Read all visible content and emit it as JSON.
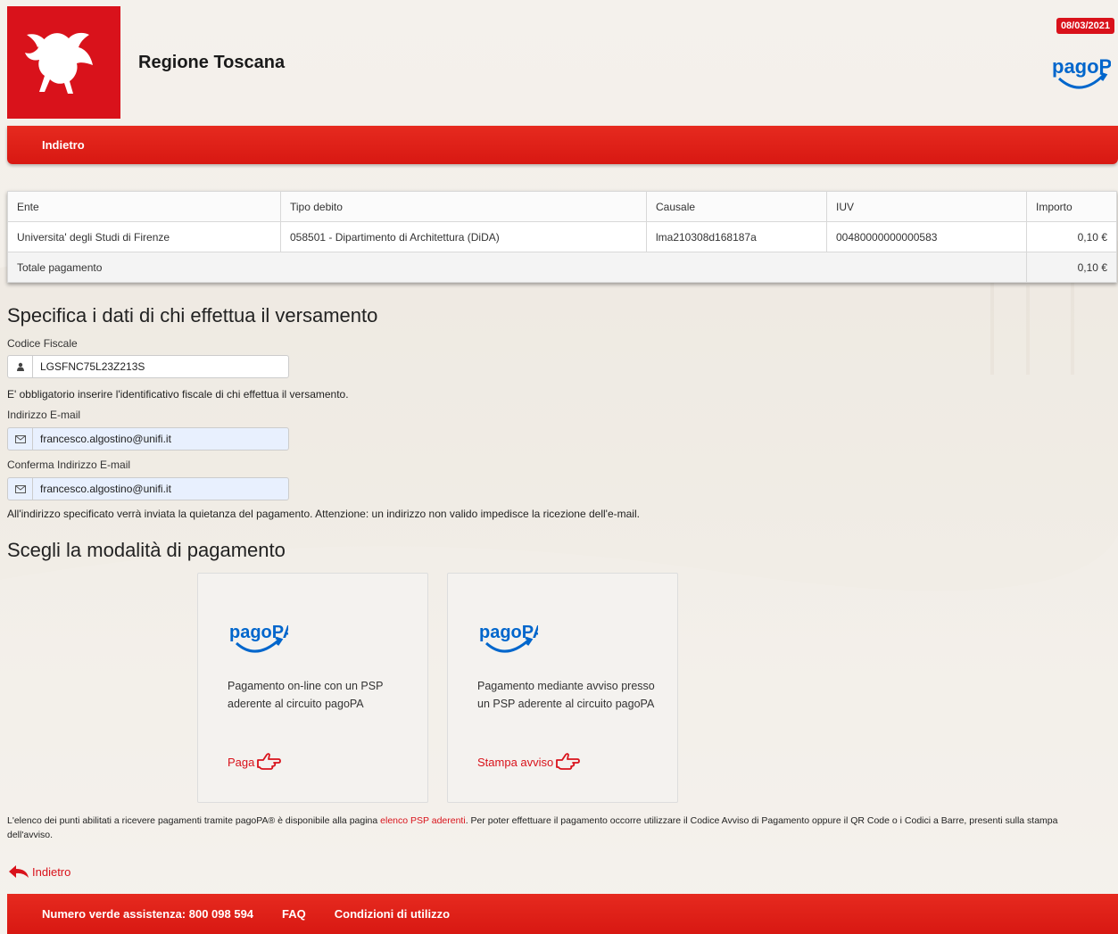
{
  "header": {
    "region_title": "Regione Toscana",
    "date": "08/03/2021",
    "pagopa_logo": "pagoPA"
  },
  "topbar": {
    "back_label": "Indietro"
  },
  "table": {
    "headers": [
      "Ente",
      "Tipo debito",
      "Causale",
      "IUV",
      "Importo"
    ],
    "rows": [
      [
        "Universita' degli Studi di Firenze",
        "058501 - Dipartimento di Architettura (DiDA)",
        "lma210308d168187a",
        "00480000000000583",
        "0,10 €"
      ]
    ],
    "total_label": "Totale pagamento",
    "total_value": "0,10 €"
  },
  "payer": {
    "title": "Specifica i dati di chi effettua il versamento",
    "cf_label": "Codice Fiscale",
    "cf_value": "LGSFNC75L23Z213S",
    "cf_help": "E' obbligatorio inserire l'identificativo fiscale di chi effettua il versamento.",
    "email_label": "Indirizzo E-mail",
    "email_value": "francesco.algostino@unifi.it",
    "email_confirm_label": "Conferma Indirizzo E-mail",
    "email_confirm_value": "francesco.algostino@unifi.it",
    "email_help": "All'indirizzo specificato verrà inviata la quietanza del pagamento. Attenzione: un indirizzo non valido impedisce la ricezione dell'e-mail."
  },
  "payment": {
    "title": "Scegli la modalità di pagamento",
    "cards": [
      {
        "logo": "pagoPA",
        "desc": "Pagamento on-line con un PSP aderente al circuito pagoPA",
        "action": "Paga"
      },
      {
        "logo": "pagoPA",
        "desc": "Pagamento mediante avviso presso un PSP aderente al circuito pagoPA",
        "action": "Stampa avviso"
      }
    ]
  },
  "footnote": {
    "before": "L'elenco dei punti abilitati a ricevere pagamenti tramite pagoPA® è disponibile alla pagina ",
    "link": "elenco PSP aderenti",
    "after": ". Per poter effettuare il pagamento occorre utilizzare il Codice Avviso di Pagamento oppure il QR Code o i Codici a Barre, presenti sulla stampa dell'avviso."
  },
  "back_label": "Indietro",
  "footer": {
    "helpline": "Numero verde assistenza: 800 098 594",
    "faq": "FAQ",
    "terms": "Condizioni di utilizzo"
  },
  "colors": {
    "brand_red": "#d9121b",
    "pagopa_blue": "#0066cc"
  },
  "icons": {
    "user": "user-icon",
    "email": "envelope-icon",
    "hand": "pointing-hand-icon",
    "back": "back-arrow-icon",
    "pegasus": "pegasus-logo-icon"
  }
}
